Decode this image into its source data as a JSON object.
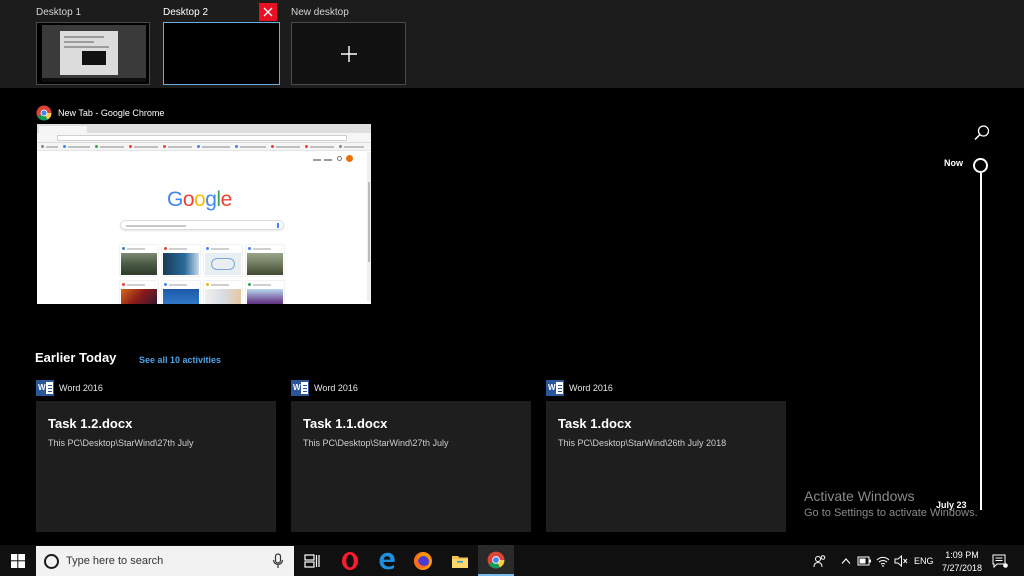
{
  "desktops": [
    {
      "label": "Desktop 1",
      "icon": "desktop-thumbnail"
    },
    {
      "label": "Desktop 2",
      "icon": "desktop-thumbnail",
      "active": true
    },
    {
      "label": "New desktop",
      "icon": "plus-icon"
    }
  ],
  "window": {
    "title": "New Tab - Google Chrome",
    "icon": "chrome-icon",
    "logo_text": "Google"
  },
  "timeline": {
    "heading": "Earlier Today",
    "see_all": "See all 10 activities",
    "now_label": "Now",
    "date_label": "July 23",
    "activities": [
      {
        "app": "Word 2016",
        "title": "Task 1.2.docx",
        "path": "This PC\\Desktop\\StarWind\\27th July"
      },
      {
        "app": "Word 2016",
        "title": "Task 1.1.docx",
        "path": "This PC\\Desktop\\StarWind\\27th July"
      },
      {
        "app": "Word 2016",
        "title": "Task 1.docx",
        "path": "This PC\\Desktop\\StarWind\\26th July 2018"
      }
    ]
  },
  "watermark": {
    "title": "Activate Windows",
    "subtitle": "Go to Settings to activate Windows."
  },
  "taskbar": {
    "search_placeholder": "Type here to search",
    "apps": [
      "task-view-icon",
      "opera-icon",
      "edge-icon",
      "firefox-icon",
      "file-explorer-icon",
      "chrome-icon"
    ],
    "tray": {
      "lang": "ENG",
      "time": "1:09 PM",
      "date": "7/27/2018"
    }
  },
  "colors": {
    "accent": "#76b9ed",
    "close_red": "#e81123",
    "word_blue": "#2b579a",
    "link_blue": "#4ea3e8"
  }
}
